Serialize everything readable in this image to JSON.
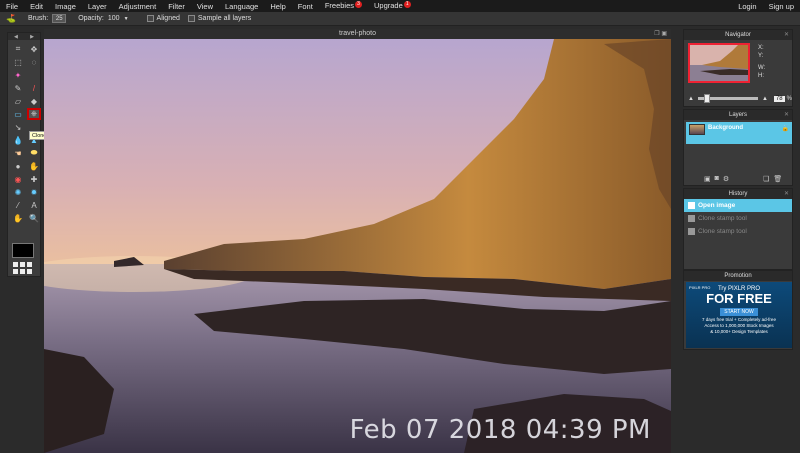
{
  "menubar": {
    "items": [
      "File",
      "Edit",
      "Image",
      "Layer",
      "Adjustment",
      "Filter",
      "View",
      "Language",
      "Help",
      "Font",
      "Freebies",
      "Upgrade"
    ],
    "freebies_badge": "3",
    "upgrade_badge": "1",
    "login": "Login",
    "signup": "Sign up"
  },
  "optionsbar": {
    "brush_label": "Brush:",
    "brush_size": "25",
    "opacity_label": "Opacity:",
    "opacity_value": "100",
    "aligned_label": "Aligned",
    "sample_label": "Sample all layers"
  },
  "toolbox": {
    "tooltip": "Clone stamp tool (S)"
  },
  "canvas": {
    "title": "travel-photo",
    "timestamp": "Feb 07 2018 04:39 PM"
  },
  "navigator": {
    "title": "Navigator",
    "x_label": "X:",
    "y_label": "Y:",
    "w_label": "W:",
    "h_label": "H:",
    "zoom": "78"
  },
  "layers": {
    "title": "Layers",
    "layer_name": "Background"
  },
  "history": {
    "title": "History",
    "items": [
      "Open image",
      "Clone stamp tool",
      "Clone stamp tool"
    ]
  },
  "promotion": {
    "title": "Promotion",
    "brand": "PIXLR PRO",
    "try": "Try PIXLR PRO",
    "headline": "FOR FREE",
    "button": "START NOW",
    "line1": "7 days free trial + Completely ad-free",
    "line2": "Access to 1,000,000 Stock Images",
    "line3": "& 10,000+ Design Templates"
  },
  "colors": {
    "accent": "#5bc6e6",
    "badge": "#e02020",
    "selection": "#cc0000"
  }
}
